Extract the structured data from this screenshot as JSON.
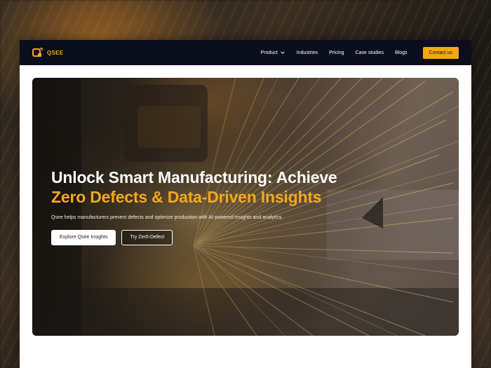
{
  "brand": {
    "name": "QSEE",
    "logo_icon": "qsee-logo-icon",
    "accent": "#f5a70f"
  },
  "nav": {
    "items": [
      {
        "label": "Product",
        "has_dropdown": true
      },
      {
        "label": "Industries"
      },
      {
        "label": "Pricing"
      },
      {
        "label": "Case studies"
      },
      {
        "label": "Blogs"
      }
    ],
    "cta": "Contact us"
  },
  "hero": {
    "title_line1": "Unlock Smart Manufacturing: Achieve",
    "title_line2": "Zero Defects & Data-Driven Insights",
    "subtitle": "Qsee helps manufacturers prevent defects and optimize production with AI-powered insights and analytics.",
    "primary_button": "Explore Qsee Insights",
    "secondary_button": "Try Zer0-Defect"
  },
  "colors": {
    "nav_bg": "#0b0e1d",
    "highlight_text": "#f6a81b",
    "page_bg": "#ffffff"
  }
}
